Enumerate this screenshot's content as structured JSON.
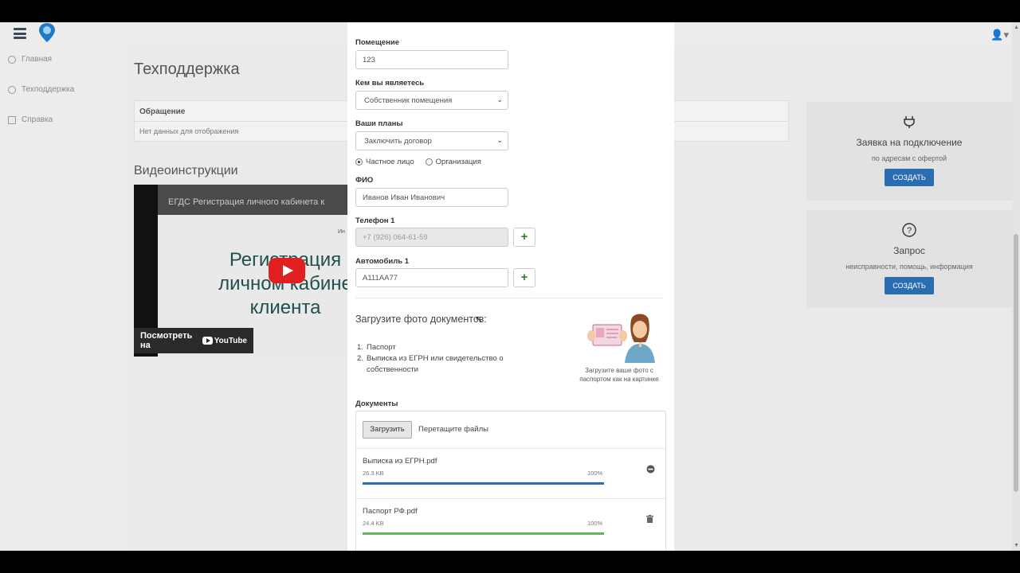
{
  "app": {
    "user_icon": "user-icon"
  },
  "sidebar": {
    "items": [
      {
        "label": "Главная",
        "icon": "home-icon"
      },
      {
        "label": "Техподдержка",
        "icon": "support-icon"
      },
      {
        "label": "Справка",
        "icon": "info-icon"
      }
    ]
  },
  "main": {
    "title": "Техподдержка",
    "table": {
      "header": "Обращение",
      "empty": "Нет данных для отображения"
    },
    "video_section_title": "Видеоинструкции",
    "video": {
      "title": "ЕГДС Регистрация личного кабинета к",
      "channel": "Ин",
      "overlay_line1": "Регистрация",
      "overlay_line2": "личном кабине",
      "overlay_line3": "клиента",
      "watch_label": "Посмотреть на",
      "youtube_label": "YouTube"
    },
    "cards": [
      {
        "icon": "plug-icon",
        "title": "Заявка на подключение",
        "subtitle": "по адресам с офертой",
        "button": "СОЗДАТЬ"
      },
      {
        "icon": "question-icon",
        "title": "Запрос",
        "subtitle": "неисправности, помощь, информация",
        "button": "СОЗДАТЬ"
      }
    ]
  },
  "form": {
    "room": {
      "label": "Помещение",
      "value": "123"
    },
    "role": {
      "label": "Кем вы являетесь",
      "value": "Собственник помещения"
    },
    "plans": {
      "label": "Ваши планы",
      "value": "Заключить договор"
    },
    "person_type": {
      "option1": "Частное лицо",
      "option2": "Организация",
      "selected": "Частное лицо"
    },
    "fio": {
      "label": "ФИО",
      "value": "Иванов Иван Иванович"
    },
    "phone": {
      "label": "Телефон 1",
      "value": "+7 (926) 064-61-59"
    },
    "car": {
      "label": "Автомобиль 1",
      "value": "А111АА77"
    },
    "upload": {
      "title": "Загрузите фото документов:",
      "list": [
        "Паспорт",
        "Выписка из ЕГРН или свидетельство о собственности"
      ],
      "caption": "Загрузите ваше фото с паспортом как на картинке"
    },
    "documents": {
      "label": "Документы",
      "upload_button": "Загрузить",
      "drop_text": "Перетащите файлы",
      "files": [
        {
          "name": "Выписка из ЕГРН.pdf",
          "size": "26.3 KB",
          "progress": "100%",
          "progress_value": 1.0,
          "color": "#2a6db0",
          "icon": "remove-icon"
        },
        {
          "name": "Паспорт РФ.pdf",
          "size": "24.4 KB",
          "progress": "100%",
          "progress_value": 1.0,
          "color": "#5cb85c",
          "icon": "trash-icon"
        }
      ]
    }
  }
}
